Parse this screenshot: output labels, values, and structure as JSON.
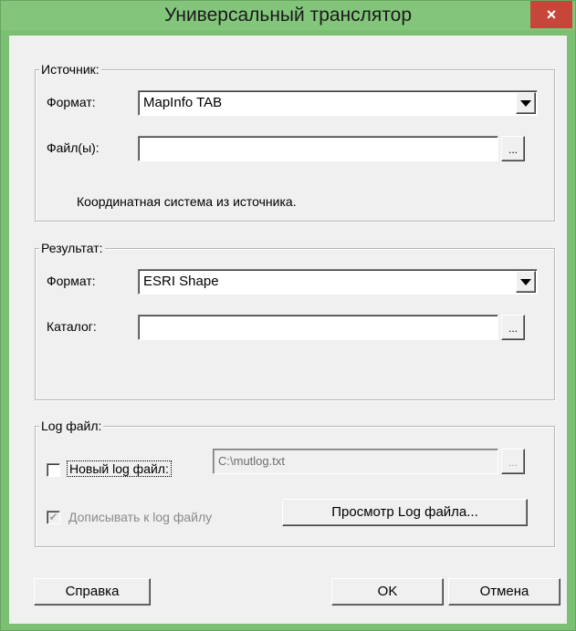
{
  "window": {
    "title": "Универсальный транслятор",
    "close_symbol": "×"
  },
  "source": {
    "group_label": "Источник:",
    "format_label": "Формат:",
    "format_value": "MapInfo TAB",
    "files_label": "Файл(ы):",
    "files_value": "",
    "browse_label": "...",
    "coord_text": "Координатная система из источника."
  },
  "result": {
    "group_label": "Результат:",
    "format_label": "Формат:",
    "format_value": "ESRI Shape",
    "catalog_label": "Каталог:",
    "catalog_value": "",
    "browse_label": "..."
  },
  "log": {
    "group_label": "Log файл:",
    "new_log_label": "Новый log файл:",
    "new_log_checked": false,
    "log_path": "C:\\mutlog.txt",
    "browse_label": "...",
    "append_label": "Дописывать к log файлу",
    "append_checked": true,
    "view_button": "Просмотр Log файла..."
  },
  "footer": {
    "help": "Справка",
    "ok": "OK",
    "cancel": "Отмена"
  },
  "colors": {
    "title_bar": "#83c57b",
    "close_button": "#c7463a",
    "dialog_bg": "#f0f0f0"
  }
}
